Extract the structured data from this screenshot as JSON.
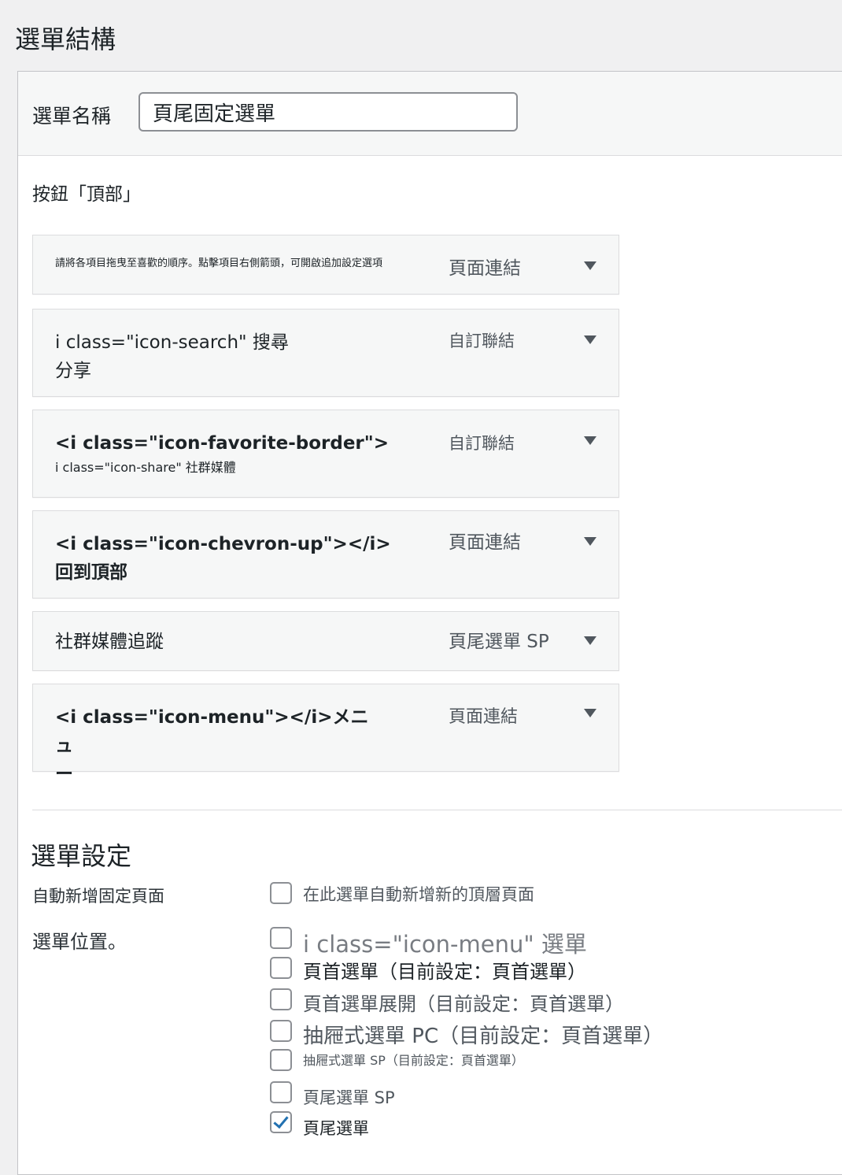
{
  "page_title": "選單結構",
  "menu_name": {
    "label": "選單名稱",
    "value": "頁尾固定選單"
  },
  "section_title": "按鈕「頂部」",
  "items": [
    {
      "title": "請將各項目拖曳至喜歡的順序。點擊項目右側箭頭，可開啟追加設定選項",
      "type": "頁面連結"
    },
    {
      "title": "i class=\"icon-search\" 搜尋",
      "subtitle": "分享",
      "type": "自訂聯結"
    },
    {
      "title": "<i class=\"icon-favorite-border\">",
      "subtitle": "i class=\"icon-share\" 社群媒體",
      "type": "自訂聯結"
    },
    {
      "title": "<i class=\"icon-chevron-up\"></i>",
      "subtitle": "回到頂部",
      "type": "頁面連結"
    },
    {
      "title": "社群媒體追蹤",
      "type": "頁尾選單 SP"
    },
    {
      "title": "<i class=\"icon-menu\"></i>メニュ",
      "subtitle": "ー",
      "type": "頁面連結"
    }
  ],
  "settings": {
    "title": "選單設定",
    "auto_add": {
      "label": "自動新增固定頁面",
      "option": "在此選單自動新增新的頂層頁面",
      "checked": false
    },
    "locations": {
      "label": "選單位置。",
      "options": [
        {
          "label": "i class=\"icon-menu\" 選單",
          "checked": false
        },
        {
          "label": "頁首選單（目前設定：頁首選單）",
          "checked": false
        },
        {
          "label": "頁首選單展開（目前設定：頁首選單）",
          "checked": false
        },
        {
          "label": "抽屜式選單 PC（目前設定：頁首選單）",
          "checked": false
        },
        {
          "label": "抽屜式選單 SP（目前設定：頁首選單）",
          "checked": false
        },
        {
          "label": "頁尾選單 SP",
          "checked": false
        },
        {
          "label": "頁尾選單",
          "checked": true
        }
      ]
    }
  }
}
